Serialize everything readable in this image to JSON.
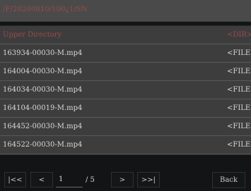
{
  "path": "/F/20200810/100¿1/SN",
  "rows": [
    {
      "name": "Upper Directory",
      "type": "<DIR>"
    },
    {
      "name": "163934-00030-M.mp4",
      "type": "<FILE>"
    },
    {
      "name": "164004-00030-M.mp4",
      "type": "<FILE>"
    },
    {
      "name": "164034-00030-M.mp4",
      "type": "<FILE>"
    },
    {
      "name": "164104-00019-M.mp4",
      "type": "<FILE>"
    },
    {
      "name": "164452-00030-M.mp4",
      "type": "<FILE>"
    },
    {
      "name": "164522-00030-M.mp4",
      "type": "<FILE>"
    }
  ],
  "pager": {
    "first_label": "|<<",
    "prev_label": "<",
    "current_page": "1",
    "total_text": "/ 5",
    "next_label": ">",
    "last_label": ">>|"
  },
  "back_label": "Back",
  "colors": {
    "accent_red": "#9a4a4a",
    "list_bg": "#3d3d3d",
    "screen_bg": "#121415"
  }
}
